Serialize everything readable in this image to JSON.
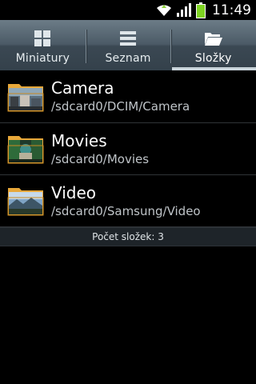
{
  "status_bar": {
    "time": "11:49",
    "icons": [
      "wifi-icon",
      "signal-icon",
      "battery-icon"
    ],
    "battery_color": "#7ed321"
  },
  "tabs": [
    {
      "label": "Miniatury",
      "icon": "grid-icon",
      "active": false
    },
    {
      "label": "Seznam",
      "icon": "list-icon",
      "active": false
    },
    {
      "label": "Složky",
      "icon": "folder-open-icon",
      "active": true
    }
  ],
  "folders": [
    {
      "name": "Camera",
      "path": "/sdcard0/DCIM/Camera",
      "icon": "folder-thumbnail-icon"
    },
    {
      "name": "Movies",
      "path": "/sdcard0/Movies",
      "icon": "folder-thumbnail-icon"
    },
    {
      "name": "Video",
      "path": "/sdcard0/Samsung/Video",
      "icon": "folder-thumbnail-icon"
    }
  ],
  "footer": {
    "folder_count": "Počet složek: 3"
  },
  "colors": {
    "tab_bar": "#4b5a66",
    "background": "#000000",
    "folder_tab": "#e8a83a"
  }
}
